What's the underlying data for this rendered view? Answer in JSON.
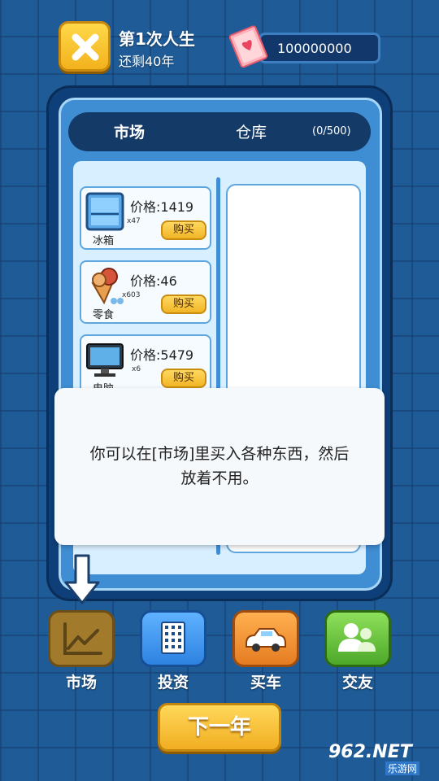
{
  "header": {
    "life_title": "第1次人生",
    "years_left": "还剩40年",
    "money": "100000000"
  },
  "tabs": {
    "market": "市场",
    "storage": "仓库",
    "storage_count": "(0/500)"
  },
  "market_items": [
    {
      "name": "冰箱",
      "price": "价格:1419",
      "qty": "x47",
      "buy": "购买",
      "icon": "fridge-icon"
    },
    {
      "name": "零食",
      "price": "价格:46",
      "qty": "x603",
      "buy": "购买",
      "icon": "snack-icon"
    },
    {
      "name": "电脑",
      "price": "价格:5479",
      "qty": "x6",
      "buy": "购买",
      "icon": "computer-icon"
    }
  ],
  "dialog": {
    "text": "你可以在[市场]里买入各种东西，然后放着不用。"
  },
  "nav": {
    "market": "市场",
    "invest": "投资",
    "car": "买车",
    "friend": "交友"
  },
  "next_year": "下一年",
  "watermark": {
    "main": "962.NET",
    "sub": "乐游网"
  },
  "colors": {
    "background": "#1f5c97",
    "panel": "#3f8dd2",
    "gold_button": "#f1b526"
  }
}
